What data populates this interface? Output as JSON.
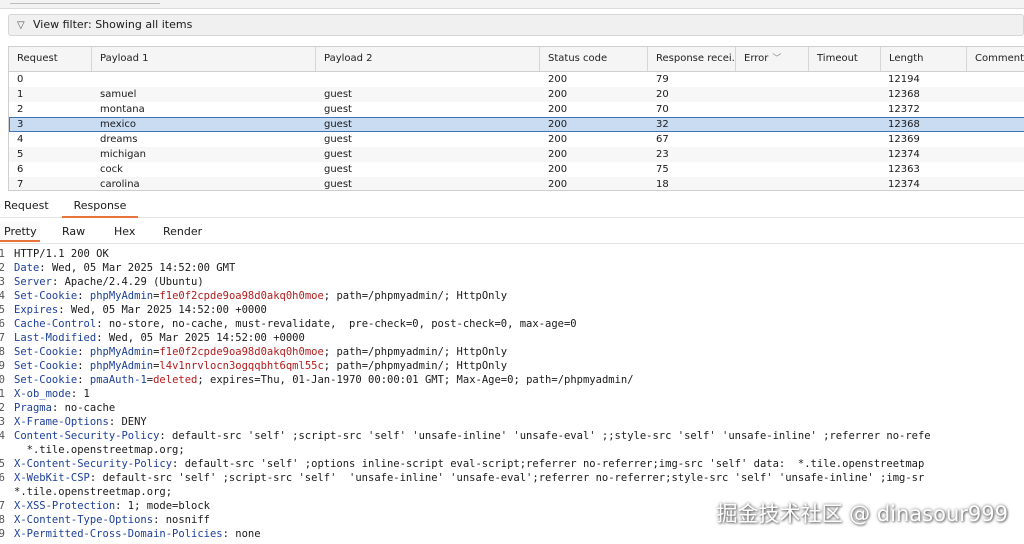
{
  "filter": {
    "label": "View filter: Showing all items",
    "icon": "funnel-icon"
  },
  "table": {
    "columns": [
      {
        "label": "Request"
      },
      {
        "label": "Payload 1"
      },
      {
        "label": "Payload 2"
      },
      {
        "label": "Status code"
      },
      {
        "label": "Response recei..."
      },
      {
        "label": "Error"
      },
      {
        "label": "Timeout"
      },
      {
        "label": "Length"
      },
      {
        "label": "Comment"
      }
    ],
    "rows": [
      {
        "request": "0",
        "p1": "",
        "p2": "",
        "status": "200",
        "resp": "79",
        "length": "12194"
      },
      {
        "request": "1",
        "p1": "samuel",
        "p2": "guest",
        "status": "200",
        "resp": "20",
        "length": "12368"
      },
      {
        "request": "2",
        "p1": "montana",
        "p2": "guest",
        "status": "200",
        "resp": "70",
        "length": "12372"
      },
      {
        "request": "3",
        "p1": "mexico",
        "p2": "guest",
        "status": "200",
        "resp": "32",
        "length": "12368",
        "selected": true
      },
      {
        "request": "4",
        "p1": "dreams",
        "p2": "guest",
        "status": "200",
        "resp": "67",
        "length": "12369"
      },
      {
        "request": "5",
        "p1": "michigan",
        "p2": "guest",
        "status": "200",
        "resp": "23",
        "length": "12374"
      },
      {
        "request": "6",
        "p1": "cock",
        "p2": "guest",
        "status": "200",
        "resp": "75",
        "length": "12363"
      },
      {
        "request": "7",
        "p1": "carolina",
        "p2": "guest",
        "status": "200",
        "resp": "18",
        "length": "12374"
      }
    ]
  },
  "tabs": {
    "request": "Request",
    "response": "Response"
  },
  "view_tabs": {
    "pretty": "Pretty",
    "raw": "Raw",
    "hex": "Hex",
    "render": "Render"
  },
  "response_lines": [
    {
      "n": "1",
      "segs": [
        {
          "t": "HTTP/1.1 200 OK"
        }
      ]
    },
    {
      "n": "2",
      "segs": [
        {
          "t": "Date",
          "c": "k"
        },
        {
          "t": ": Wed, 05 Mar 2025 14:52:00 GMT"
        }
      ]
    },
    {
      "n": "3",
      "segs": [
        {
          "t": "Server",
          "c": "k"
        },
        {
          "t": ": Apache/2.4.29 (Ubuntu)"
        }
      ]
    },
    {
      "n": "4",
      "segs": [
        {
          "t": "Set-Cookie",
          "c": "k"
        },
        {
          "t": ": "
        },
        {
          "t": "phpMyAdmin",
          "c": "k"
        },
        {
          "t": "="
        },
        {
          "t": "f1e0f2cpde9oa98d0akq0h0moe",
          "c": "r"
        },
        {
          "t": "; path=/phpmyadmin/; HttpOnly"
        }
      ]
    },
    {
      "n": "5",
      "segs": [
        {
          "t": "Expires",
          "c": "k"
        },
        {
          "t": ": Wed, 05 Mar 2025 14:52:00 +0000"
        }
      ]
    },
    {
      "n": "6",
      "segs": [
        {
          "t": "Cache-Control",
          "c": "k"
        },
        {
          "t": ": no-store, no-cache, must-revalidate,  pre-check=0, post-check=0, max-age=0"
        }
      ]
    },
    {
      "n": "7",
      "segs": [
        {
          "t": "Last-Modified",
          "c": "k"
        },
        {
          "t": ": Wed, 05 Mar 2025 14:52:00 +0000"
        }
      ]
    },
    {
      "n": "8",
      "segs": [
        {
          "t": "Set-Cookie",
          "c": "k"
        },
        {
          "t": ": "
        },
        {
          "t": "phpMyAdmin",
          "c": "k"
        },
        {
          "t": "="
        },
        {
          "t": "f1e0f2cpde9oa98d0akq0h0moe",
          "c": "r"
        },
        {
          "t": "; path=/phpmyadmin/; HttpOnly"
        }
      ]
    },
    {
      "n": "9",
      "segs": [
        {
          "t": "Set-Cookie",
          "c": "k"
        },
        {
          "t": ": "
        },
        {
          "t": "phpMyAdmin",
          "c": "k"
        },
        {
          "t": "="
        },
        {
          "t": "l4v1nrvlocn3ogqqbht6qml55c",
          "c": "r"
        },
        {
          "t": "; path=/phpmyadmin/; HttpOnly"
        }
      ]
    },
    {
      "n": "0",
      "segs": [
        {
          "t": "Set-Cookie",
          "c": "k"
        },
        {
          "t": ": "
        },
        {
          "t": "pmaAuth-1",
          "c": "k"
        },
        {
          "t": "="
        },
        {
          "t": "deleted",
          "c": "r"
        },
        {
          "t": "; expires=Thu, 01-Jan-1970 00:00:01 GMT; Max-Age=0; path=/phpmyadmin/"
        }
      ]
    },
    {
      "n": "1",
      "segs": [
        {
          "t": "X-ob_mode",
          "c": "k"
        },
        {
          "t": ": 1"
        }
      ]
    },
    {
      "n": "2",
      "segs": [
        {
          "t": "Pragma",
          "c": "k"
        },
        {
          "t": ": no-cache"
        }
      ]
    },
    {
      "n": "3",
      "segs": [
        {
          "t": "X-Frame-Options",
          "c": "k"
        },
        {
          "t": ": DENY"
        }
      ]
    },
    {
      "n": "4",
      "segs": [
        {
          "t": "Content-Security-Policy",
          "c": "k"
        },
        {
          "t": ": default-src 'self' ;script-src 'self' 'unsafe-inline' 'unsafe-eval' ;;style-src 'self' 'unsafe-inline' ;referrer no-refe"
        }
      ]
    },
    {
      "n": "",
      "segs": [
        {
          "t": "  *.tile.openstreetmap.org;"
        }
      ]
    },
    {
      "n": "5",
      "segs": [
        {
          "t": "X-Content-Security-Policy",
          "c": "k"
        },
        {
          "t": ": default-src 'self' ;options inline-script eval-script;referrer no-referrer;img-src 'self' data:  *.tile.openstreetmap"
        }
      ]
    },
    {
      "n": "6",
      "segs": [
        {
          "t": "X-WebKit-CSP",
          "c": "k"
        },
        {
          "t": ": default-src 'self' ;script-src 'self'  'unsafe-inline' 'unsafe-eval';referrer no-referrer;style-src 'self' 'unsafe-inline' ;img-sr"
        }
      ]
    },
    {
      "n": "",
      "segs": [
        {
          "t": "*.tile.openstreetmap.org;"
        }
      ]
    },
    {
      "n": "7",
      "segs": [
        {
          "t": "X-XSS-Protection",
          "c": "k"
        },
        {
          "t": ": 1; mode=block"
        }
      ]
    },
    {
      "n": "8",
      "segs": [
        {
          "t": "X-Content-Type-Options",
          "c": "k"
        },
        {
          "t": ": nosniff"
        }
      ]
    },
    {
      "n": "9",
      "segs": [
        {
          "t": "X-Permitted-Cross-Domain-Policies",
          "c": "k"
        },
        {
          "t": ": none"
        }
      ]
    }
  ],
  "watermark": "掘金技术社区 @ dinasour999"
}
